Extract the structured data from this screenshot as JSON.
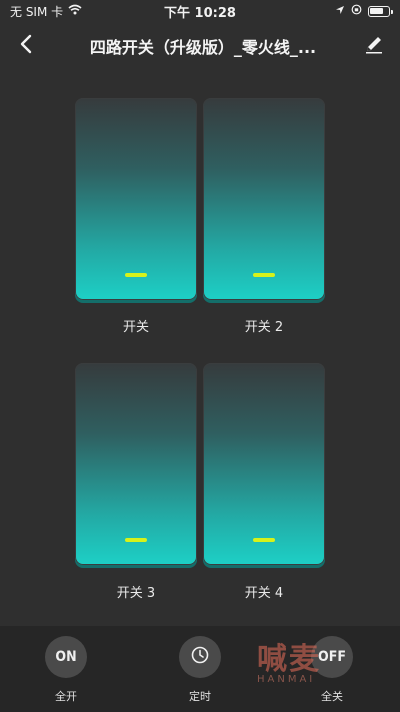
{
  "status_bar": {
    "carrier": "无 SIM 卡",
    "time": "下午 10:28"
  },
  "nav": {
    "title": "四路开关（升级版）_零火线_..."
  },
  "switches": [
    {
      "label": "开关",
      "state": "on"
    },
    {
      "label": "开关 2",
      "state": "on"
    },
    {
      "label": "开关 3",
      "state": "on"
    },
    {
      "label": "开关 4",
      "state": "on"
    }
  ],
  "actions": {
    "all_on": {
      "button_text": "ON",
      "label": "全开"
    },
    "timer": {
      "label": "定时"
    },
    "all_off": {
      "button_text": "OFF",
      "label": "全关"
    }
  },
  "watermark": {
    "text": "喊麦",
    "sub": "HANMAI"
  },
  "colors": {
    "background": "#2f2f2f",
    "switch_gradient_top": "#363b3d",
    "switch_gradient_bottom": "#1dd0c6",
    "indicator": "#d6f21a",
    "bottom_bar": "#262626"
  },
  "icons": [
    "wifi-icon",
    "location-icon",
    "orientation-lock-icon",
    "battery-icon",
    "back-arrow-icon",
    "edit-pencil-icon",
    "clock-icon"
  ]
}
